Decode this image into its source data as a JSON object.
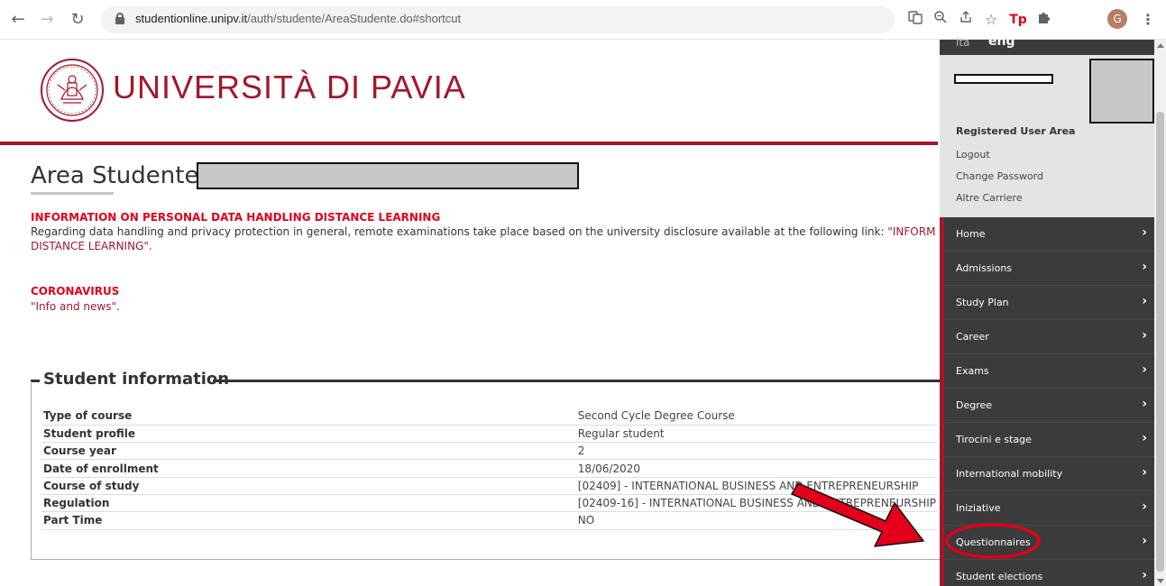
{
  "browser": {
    "url_host": "studentionline.unipv.it",
    "url_path": "/auth/studente/AreaStudente.do#shortcut",
    "profile_initial": "G",
    "icons": [
      "back-icon",
      "forward-icon",
      "reload-icon",
      "lock-icon",
      "translate-icon",
      "zoom-icon",
      "share-icon",
      "bookmark-star-icon",
      "tp-extension-icon",
      "puzzle-extensions-icon",
      "menu-dots-icon"
    ]
  },
  "header": {
    "university_name": "UNIVERSITÀ DI PAVIA",
    "brand_color": "#a4172c"
  },
  "page": {
    "title": "Area Studente"
  },
  "notices": {
    "privacy_heading": "INFORMATION ON PERSONAL DATA HANDLING DISTANCE LEARNING",
    "privacy_text": "Regarding data handling and privacy protection in general, remote examinations take place based on the university disclosure available at the following link: ",
    "privacy_link_1": "\"INFORMA",
    "privacy_link_2": "DISTANCE LEARNING\".",
    "corona_heading": "CORONAVIRUS",
    "corona_link": "\"Info and news\"."
  },
  "student_info": {
    "legend": "Student information",
    "rows": [
      {
        "label": "Type of course",
        "value": "Second Cycle Degree Course"
      },
      {
        "label": "Student profile",
        "value": "Regular student"
      },
      {
        "label": "Course year",
        "value": "2"
      },
      {
        "label": "Date of enrollment",
        "value": "18/06/2020"
      },
      {
        "label": "Course of study",
        "value": "[02409] - INTERNATIONAL BUSINESS AND ENTREPRENEURSHIP"
      },
      {
        "label": "Regulation",
        "value": "[02409-16] - INTERNATIONAL BUSINESS AND ENTREPRENEURSHIP"
      },
      {
        "label": "Part Time",
        "value": "NO"
      }
    ]
  },
  "sidebar": {
    "lang_ita": "ita",
    "lang_eng": "eng",
    "registered_heading": "Registered User Area",
    "logout": "Logout",
    "change_password": "Change Password",
    "altre_carriere": "Altre Carriere",
    "menu": [
      {
        "label": "Home"
      },
      {
        "label": "Admissions"
      },
      {
        "label": "Study Plan"
      },
      {
        "label": "Career"
      },
      {
        "label": "Exams"
      },
      {
        "label": "Degree"
      },
      {
        "label": "Tirocini e stage"
      },
      {
        "label": "International mobility"
      },
      {
        "label": "Iniziative"
      },
      {
        "label": "Questionnaires"
      },
      {
        "label": "Student elections"
      }
    ],
    "chevron": "›"
  },
  "annotation": {
    "arrow_color": "#e2001a",
    "highlighted_item": "Questionnaires"
  }
}
